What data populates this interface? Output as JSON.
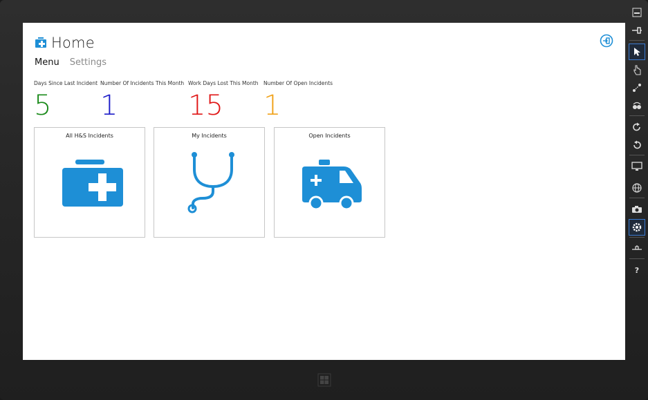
{
  "app": {
    "title": "Home",
    "logo_icon": "first-aid-kit-icon",
    "logout_icon": "sign-out-icon",
    "accent": "#1e8fd6"
  },
  "tabs": [
    {
      "label": "Menu",
      "active": true
    },
    {
      "label": "Settings",
      "active": false
    }
  ],
  "stats": [
    {
      "label": "Days Since Last Incident",
      "value": "5",
      "color": "#1a8a1a"
    },
    {
      "label": "Number Of Incidents This Month",
      "value": "1",
      "color": "#1c1cc8"
    },
    {
      "label": "Work Days Lost This Month",
      "value": "15",
      "color": "#e01616"
    },
    {
      "label": "Number Of Open Incidents",
      "value": "1",
      "color": "#f0a21a"
    }
  ],
  "tiles": [
    {
      "title": "All H&S Incidents",
      "icon": "first-aid-kit-icon"
    },
    {
      "title": "My Incidents",
      "icon": "stethoscope-icon"
    },
    {
      "title": "Open Incidents",
      "icon": "ambulance-icon"
    }
  ],
  "toolbar": {
    "items": [
      "minimize-icon",
      "pin-icon",
      "pointer-icon",
      "touch-icon",
      "pinch-icon",
      "rotate-touch-icon",
      "rotate-clockwise-icon",
      "rotate-counterclockwise-icon",
      "display-icon",
      "globe-icon",
      "camera-icon",
      "settings-icon",
      "network-icon",
      "help-icon"
    ],
    "help_label": "?"
  },
  "windows_button_icon": "windows-logo-icon"
}
